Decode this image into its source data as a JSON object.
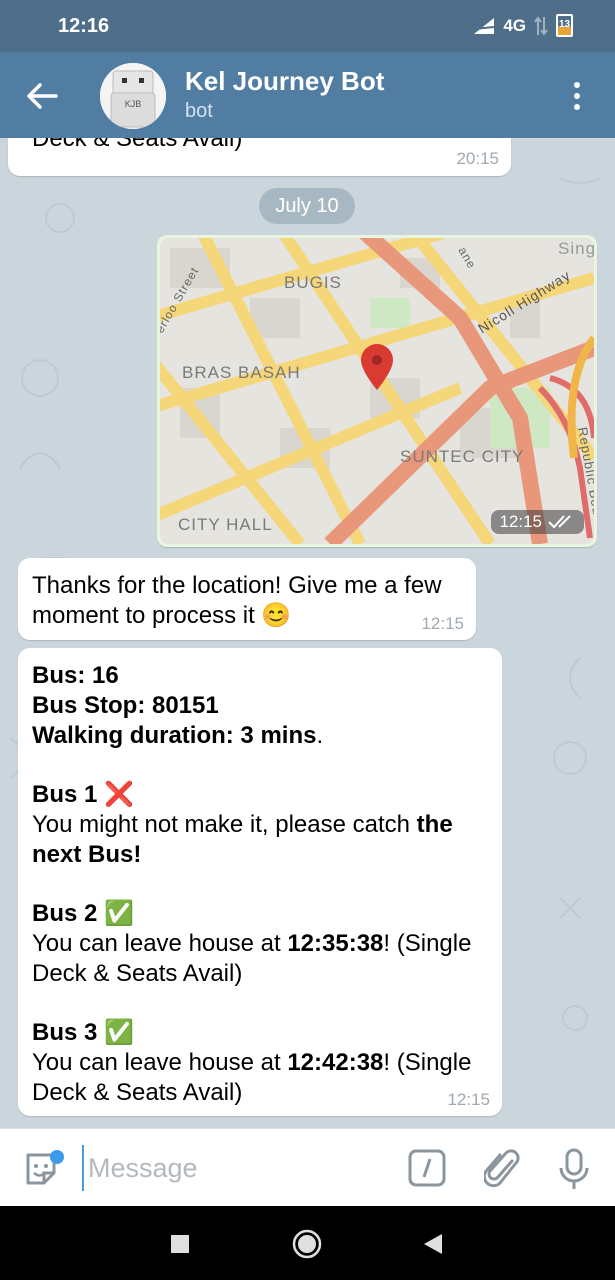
{
  "status": {
    "time": "12:16",
    "network": "4G",
    "battery": "13"
  },
  "header": {
    "title": "Kel Journey Bot",
    "subtitle": "bot",
    "avatar_text": "KJB"
  },
  "chat": {
    "prev_message": {
      "text": "Deck & Seats Avail)",
      "time": "20:15"
    },
    "date_separator": "July 10",
    "location_message": {
      "time": "12:15",
      "map_labels": [
        "BUGIS",
        "BRAS BASAH",
        "SUNTEC CITY",
        "CITY HALL",
        "Nicoll Highway",
        "erloo Street",
        "Republic Bou",
        "Sing",
        "ane"
      ]
    },
    "ack_message": {
      "text_a": "Thanks for the location! Give me a few",
      "text_b": "moment to process it",
      "emoji": "😊",
      "time": "12:15"
    },
    "result_message": {
      "bus_line": "Bus: 16",
      "stop_line": "Bus Stop: 80151",
      "walk_label": "Walking duration: 3 mins",
      "walk_dot": ".",
      "bus1_title": "Bus 1",
      "bus1_icon": "❌",
      "bus1_text": "You might not make it, please catch ",
      "bus1_bold_a": "the",
      "bus1_bold_b": "next Bus!",
      "bus2_title": "Bus 2",
      "bus2_icon": "✅",
      "bus2_text_a": "You can leave house at ",
      "bus2_time": "12:35:38",
      "bus2_text_b": "! (Single",
      "bus2_text_c": "Deck & Seats Avail)",
      "bus3_title": "Bus 3",
      "bus3_icon": "✅",
      "bus3_text_a": "You can leave house at ",
      "bus3_time": "12:42:38",
      "bus3_text_b": "! (Single",
      "bus3_text_c": "Deck & Seats Avail)",
      "time": "12:15"
    }
  },
  "input": {
    "placeholder": "Message"
  },
  "icons": {
    "back": "arrow-left-icon",
    "menu": "more-vert-icon",
    "sticker": "sticker-icon",
    "command": "slash-command-icon",
    "attach": "paperclip-icon",
    "mic": "microphone-icon",
    "pin": "location-pin-icon",
    "read": "double-check-icon"
  },
  "colors": {
    "header": "#527da3",
    "status": "#4e6e89",
    "accent": "#4f9bd6",
    "pin": "#d93a32",
    "error": "#e02a2a",
    "success": "#4caf50"
  }
}
